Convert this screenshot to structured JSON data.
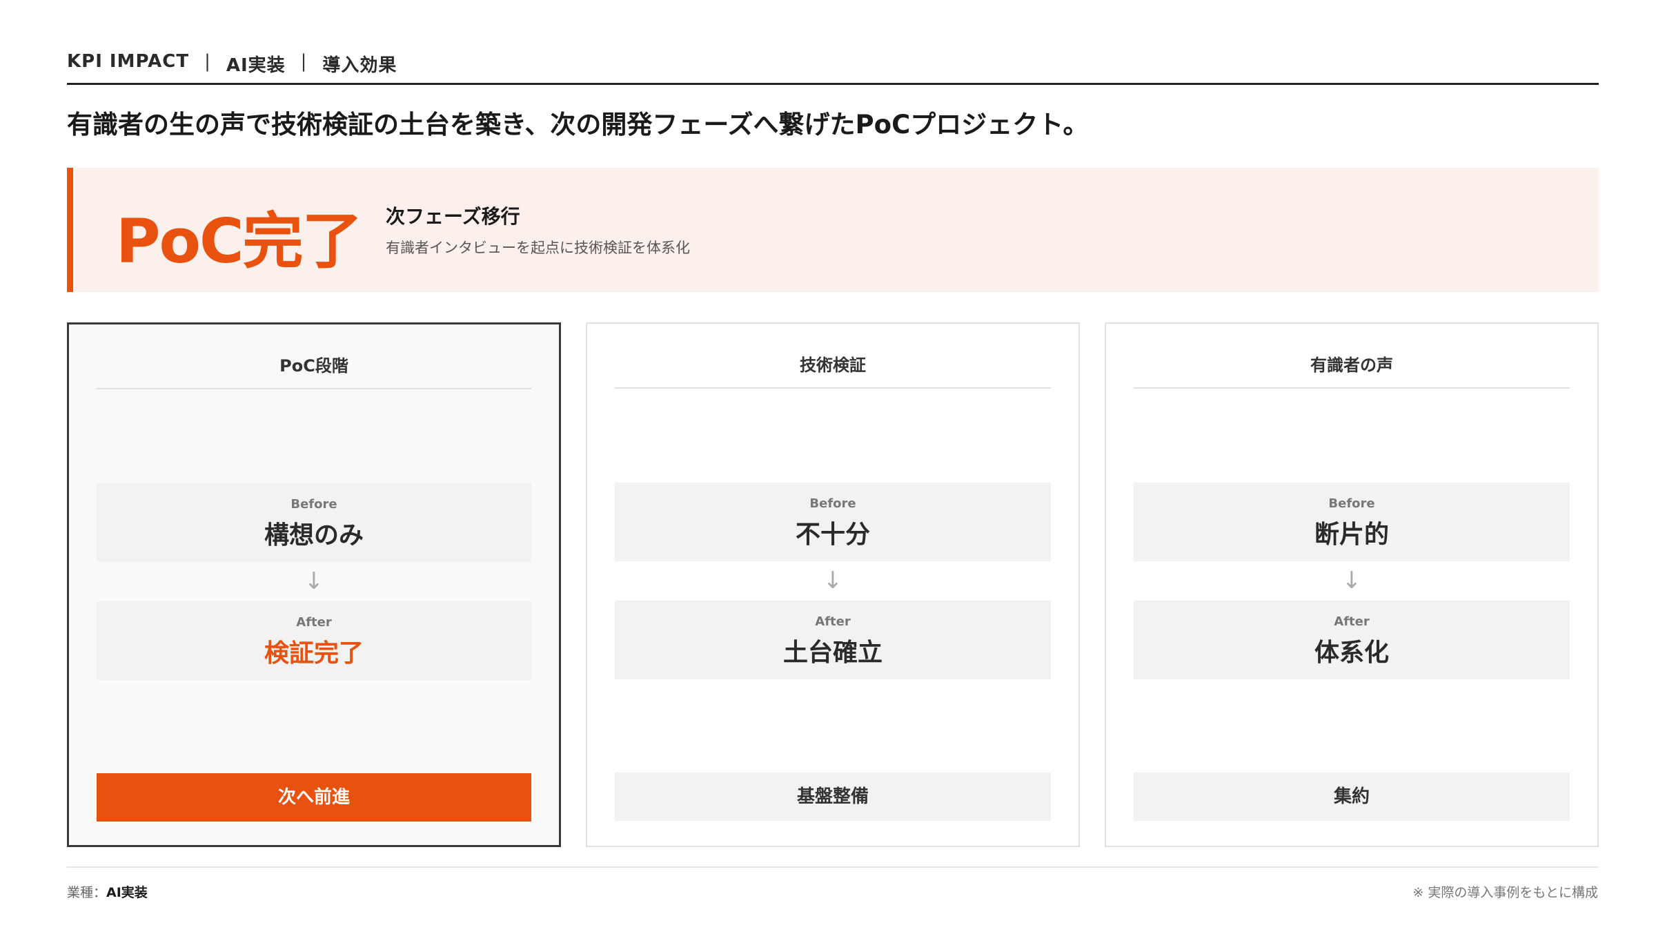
{
  "header": {
    "tag": "KPI IMPACT",
    "category": "AI実装",
    "section": "導入効果",
    "separator": "|"
  },
  "headline": "有識者の生の声で技術検証の土台を築き、次の開発フェーズへ繋げたPoCプロジェクト。",
  "banner": {
    "big_text": "PoC完了",
    "subtitle": "次フェーズ移行",
    "description": "有識者インタビューを起点に技術検証を体系化"
  },
  "cards": [
    {
      "title": "PoC段階",
      "before_label": "Before",
      "before_value": "構想のみ",
      "arrow": "↓",
      "after_label": "After",
      "after_value": "検証完了",
      "footer": "次へ前進"
    },
    {
      "title": "技術検証",
      "before_label": "Before",
      "before_value": "不十分",
      "arrow": "↓",
      "after_label": "After",
      "after_value": "土台確立",
      "footer": "基盤整備"
    },
    {
      "title": "有識者の声",
      "before_label": "Before",
      "before_value": "断片的",
      "arrow": "↓",
      "after_label": "After",
      "after_value": "体系化",
      "footer": "集約"
    }
  ],
  "footer": {
    "industry_label": "業種：",
    "industry_value": "AI実装",
    "note": "※ 実際の導入事例をもとに構成"
  },
  "colors": {
    "accent": "#e8520e",
    "banner_bg": "#fcf0ec",
    "box_bg": "#f2f2f2"
  }
}
